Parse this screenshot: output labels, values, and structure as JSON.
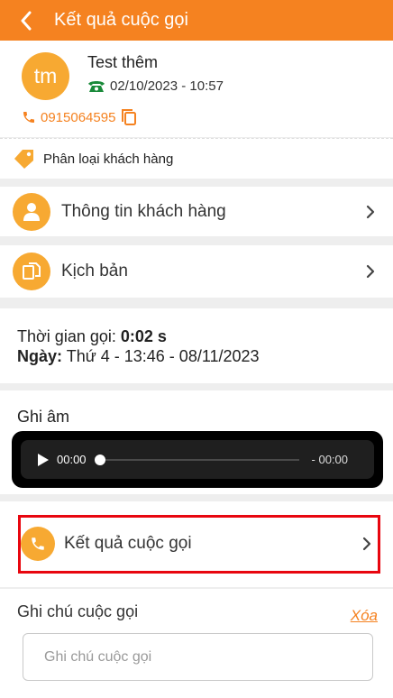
{
  "header": {
    "title": "Kết quả cuộc gọi"
  },
  "contact": {
    "avatar_initials": "tm",
    "name": "Test thêm",
    "datetime": "02/10/2023 - 10:57",
    "phone": "0915064595"
  },
  "classification": {
    "label": "Phân loại khách hàng"
  },
  "menu": {
    "customer_info": "Thông tin khách hàng",
    "script": "Kịch bản",
    "call_result": "Kết quả cuộc gọi"
  },
  "call_info": {
    "duration_label": "Thời gian gọi:",
    "duration_value": "0:02 s",
    "date_label": "Ngày:",
    "date_value": "Thứ 4 - 13:46 - 08/11/2023"
  },
  "recording": {
    "title": "Ghi âm",
    "current_time": "00:00",
    "remaining_time": "- 00:00",
    "progress": 0
  },
  "note": {
    "title": "Ghi chú cuộc gọi",
    "clear_label": "Xóa",
    "placeholder": "Ghi chú cuộc gọi",
    "value": ""
  },
  "colors": {
    "primary": "#f58220",
    "icon_bg": "#f7a932",
    "highlight": "#e8060f",
    "phone_icon_green": "#1a8a3a"
  },
  "icons": {
    "back": "chevron-left-icon",
    "phone_handset": "telephone-icon",
    "copy": "copy-icon",
    "tag": "tag-icon",
    "user": "user-icon",
    "document": "document-icon",
    "play": "play-icon",
    "chevron": "chevron-right-icon"
  }
}
